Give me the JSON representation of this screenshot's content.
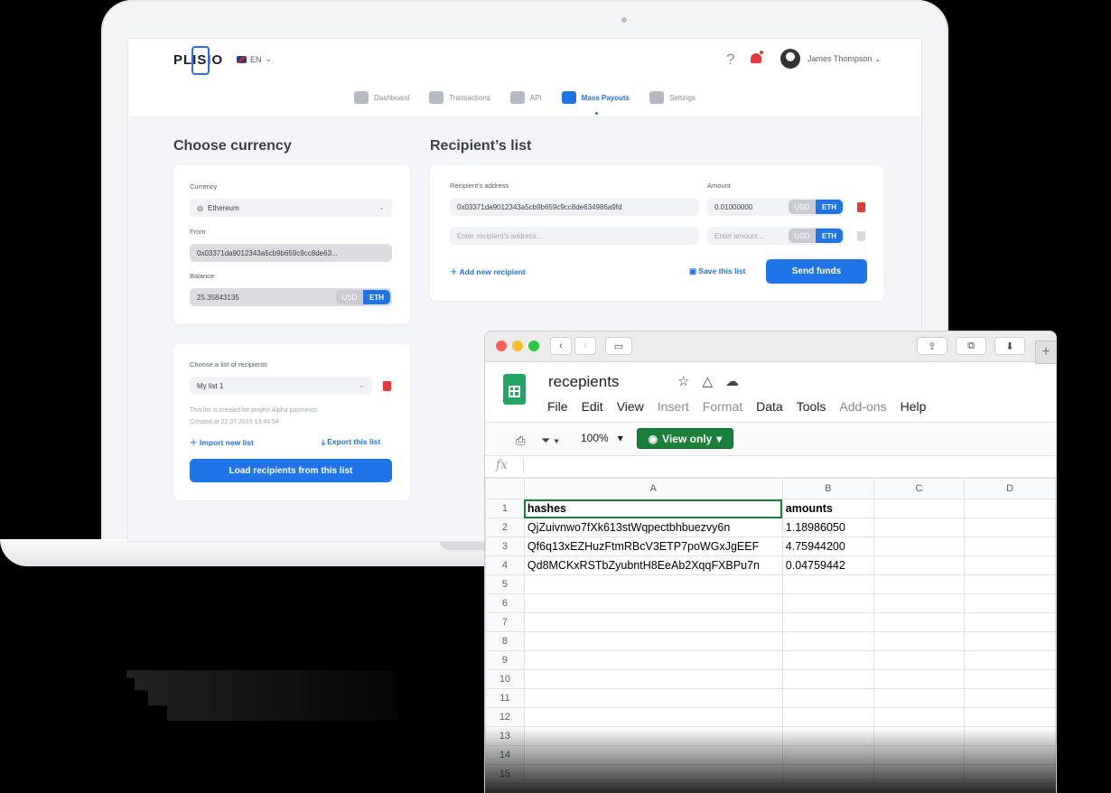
{
  "app": {
    "logo": "PLISIO",
    "language": "EN",
    "help": "?",
    "user": "James Thompson"
  },
  "nav": [
    {
      "label": "Dashboard",
      "icon": "home-icon"
    },
    {
      "label": "Transactions",
      "icon": "calendar-icon"
    },
    {
      "label": "API",
      "icon": "puzzle-icon"
    },
    {
      "label": "Mass Payouts",
      "icon": "payouts-icon",
      "active": true
    },
    {
      "label": "Settings",
      "icon": "gear-icon"
    }
  ],
  "currency": {
    "heading": "Choose currency",
    "currency_label": "Currency",
    "currency_value": "Ethereum",
    "from_label": "From",
    "from_value": "0x03371da9012343a5cb9b659c9cc8de63...",
    "balance_label": "Balance",
    "balance_value": "25.35843135",
    "toggle_usd": "USD",
    "toggle_eth": "ETH"
  },
  "recipients_list": {
    "label": "Choose a list of recipients",
    "selected": "My list 1",
    "note": "This list is created for project Alpha payments",
    "created": "Created at 22.07.2019 13:44:54",
    "import": "Import new list",
    "export": "Export this list",
    "load_button": "Load recipients from this list"
  },
  "recipients": {
    "heading": "Recipient’s list",
    "address_label": "Recipient's address",
    "amount_label": "Amount",
    "rows": [
      {
        "address": "0x03371da9012343a5cb9b659c9cc8de634986a9fd",
        "amount": "0.01000000"
      }
    ],
    "address_placeholder": "Enter recipient's address...",
    "amount_placeholder": "Enter amount...",
    "toggle_usd": "USD",
    "toggle_eth": "ETH",
    "add": "Add new recipient",
    "save": "Save this list",
    "send": "Send funds"
  },
  "sheet": {
    "title": "recepients",
    "menu": [
      "File",
      "Edit",
      "View",
      "Insert",
      "Format",
      "Data",
      "Tools",
      "Add-ons",
      "Help"
    ],
    "menu_muted": [
      "Insert",
      "Format",
      "Add-ons"
    ],
    "zoom": "100%",
    "view_only": "View only",
    "fx": "fx",
    "columns": [
      "A",
      "B",
      "C",
      "D"
    ],
    "rows": [
      [
        "hashes",
        "amounts"
      ],
      [
        "QjZuivnwo7fXk613stWqpectbhbuezvy6n",
        "1.18986050"
      ],
      [
        "Qf6q13xEZHuzFtmRBcV3ETP7poWGxJgEEF",
        "4.75944200"
      ],
      [
        "Qd8MCKxRSTbZyubntH8EeAb2XqqFXBPu7n",
        "0.04759442"
      ]
    ],
    "row_numbers": [
      "1",
      "2",
      "3",
      "4",
      "5",
      "6",
      "7",
      "8",
      "9",
      "10",
      "11",
      "12",
      "13",
      "14",
      "15"
    ]
  },
  "colors": {
    "accent": "#1f74e8",
    "danger": "#e63838",
    "sheets_green": "#188038"
  }
}
